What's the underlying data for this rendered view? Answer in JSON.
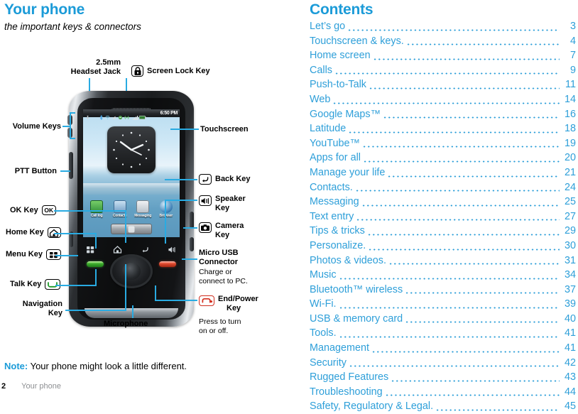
{
  "left": {
    "title": "Your phone",
    "subtitle": "the important keys & connectors",
    "note_keyword": "Note:",
    "note_text": " Your phone might look a little different.",
    "footer_page": "2",
    "footer_section": "Your phone",
    "accent_color": "#1b9bd8",
    "leader_color": "#29abe2"
  },
  "callouts": {
    "headset_jack_line1": "2.5mm",
    "headset_jack_line2": "Headset Jack",
    "screen_lock_key": "Screen Lock Key",
    "volume_keys": "Volume Keys",
    "ptt_button": "PTT Button",
    "ok_key": "OK Key",
    "home_key": "Home Key",
    "menu_key": "Menu Key",
    "talk_key": "Talk Key",
    "navigation_key_line1": "Navigation",
    "navigation_key_line2": "Key",
    "microphone": "Microphone",
    "touchscreen": "Touchscreen",
    "back_key": "Back Key",
    "speaker_key_line1": "Speaker",
    "speaker_key_line2": "Key",
    "camera_key_line1": "Camera",
    "camera_key_line2": "Key",
    "micro_usb_line1": "Micro USB",
    "micro_usb_line2": "Connector",
    "micro_usb_desc_line1": "Charge or",
    "micro_usb_desc_line2": "connect to PC.",
    "end_power_line1": "End/Power",
    "end_power_line2": "Key",
    "end_power_desc_line1": "Press to turn",
    "end_power_desc_line2": "on or off."
  },
  "phone_screen": {
    "status_time": "6:50 PM",
    "status_icons": [
      "usb-icon",
      "bluetooth-icon",
      "wifi-icon",
      "vibrate-icon",
      "sync-icon",
      "ptt-icon",
      "signal-icon",
      "battery-icon"
    ],
    "apps": [
      {
        "label": "Call log",
        "icon": "call-log-icon"
      },
      {
        "label": "Contacts",
        "icon": "contacts-icon"
      },
      {
        "label": "Messaging",
        "icon": "messaging-icon"
      },
      {
        "label": "Browser",
        "icon": "browser-icon"
      }
    ],
    "widget": "analog-clock-widget"
  },
  "contents": {
    "title": "Contents",
    "entries": [
      {
        "label": "Let’s go",
        "page": "3"
      },
      {
        "label": "Touchscreen & keys.",
        "page": "4"
      },
      {
        "label": "Home screen",
        "page": "7"
      },
      {
        "label": "Calls",
        "page": "9"
      },
      {
        "label": "Push-to-Talk",
        "page": "11"
      },
      {
        "label": "Web",
        "page": "14"
      },
      {
        "label": "Google Maps™",
        "page": "16"
      },
      {
        "label": "Latitude",
        "page": "18"
      },
      {
        "label": "YouTube™",
        "page": "19"
      },
      {
        "label": "Apps for all",
        "page": "20"
      },
      {
        "label": "Manage your life",
        "page": "21"
      },
      {
        "label": "Contacts.",
        "page": "24"
      },
      {
        "label": "Messaging",
        "page": "25"
      },
      {
        "label": "Text entry",
        "page": "27"
      },
      {
        "label": "Tips & tricks",
        "page": "29"
      },
      {
        "label": "Personalize.",
        "page": "30"
      },
      {
        "label": "Photos & videos.",
        "page": "31"
      },
      {
        "label": "Music",
        "page": "34"
      },
      {
        "label": "Bluetooth™ wireless",
        "page": "37"
      },
      {
        "label": "Wi-Fi.",
        "page": "39"
      },
      {
        "label": "USB & memory card",
        "page": "40"
      },
      {
        "label": "Tools.",
        "page": "41"
      },
      {
        "label": "Management",
        "page": "41"
      },
      {
        "label": "Security",
        "page": "42"
      },
      {
        "label": "Rugged Features",
        "page": "43"
      },
      {
        "label": "Troubleshooting",
        "page": "44"
      },
      {
        "label": "Safety, Regulatory & Legal.",
        "page": "45"
      }
    ]
  }
}
